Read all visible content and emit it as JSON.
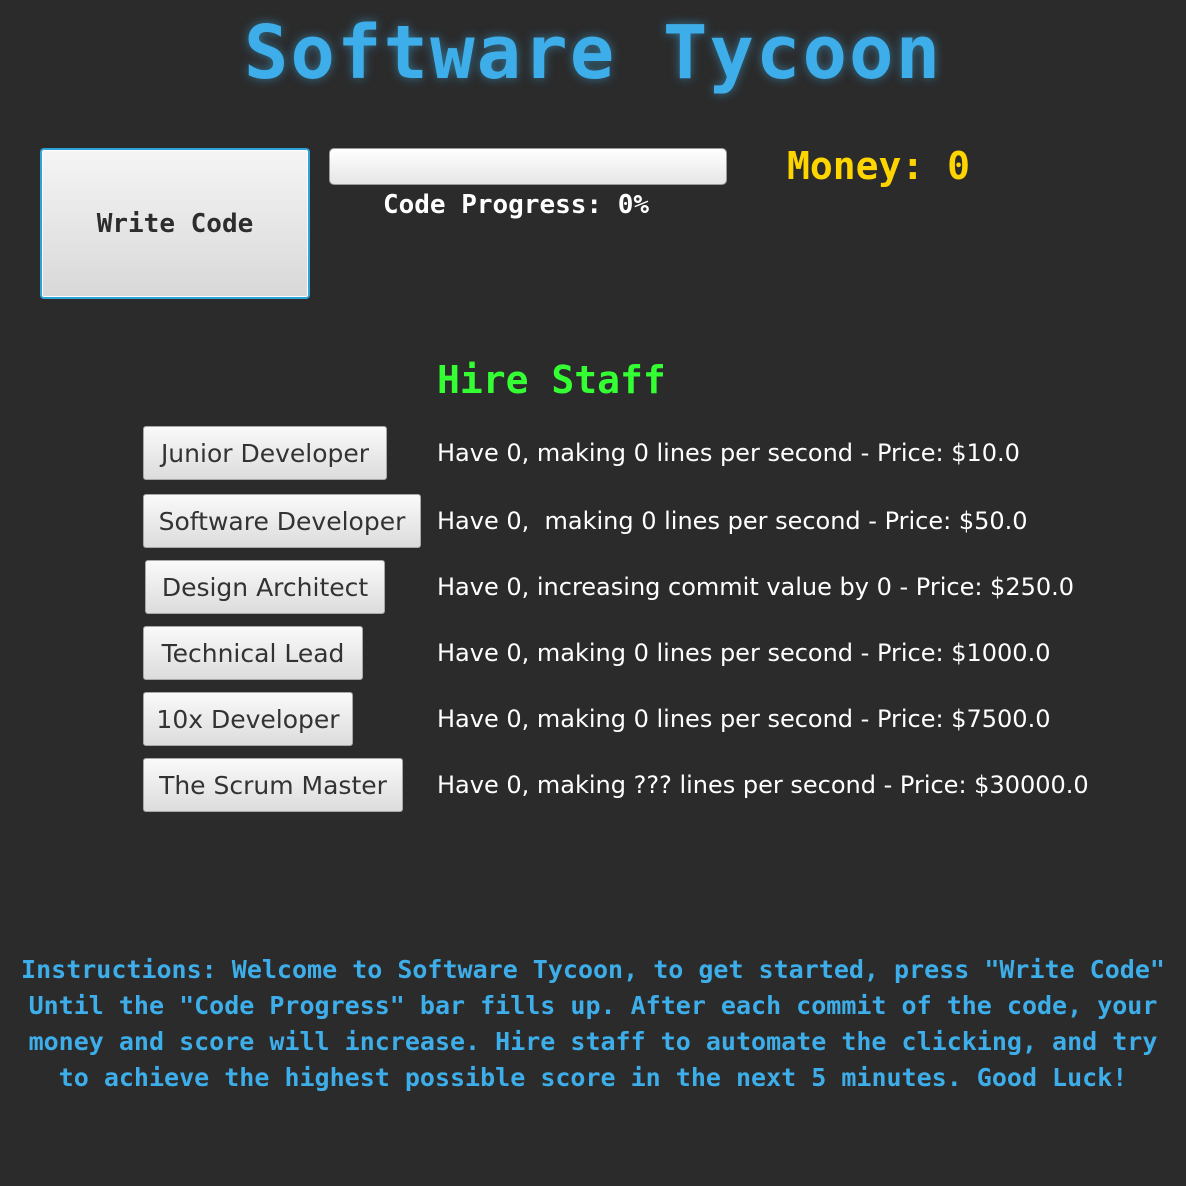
{
  "title": "Software Tycoon",
  "write_code_label": "Write Code",
  "progress": {
    "fraction": 0,
    "label": "Code Progress: 0%"
  },
  "money_label": "Money: 0",
  "hire_heading": "Hire Staff",
  "staff": [
    {
      "button": "Junior Developer",
      "desc": "Have 0, making 0 lines per second - Price: $10.0"
    },
    {
      "button": "Software Developer",
      "desc": "Have 0,  making 0 lines per second - Price: $50.0"
    },
    {
      "button": "Design Architect",
      "desc": "Have 0, increasing commit value by 0 - Price: $250.0"
    },
    {
      "button": "Technical Lead",
      "desc": "Have 0, making 0 lines per second - Price: $1000.0"
    },
    {
      "button": "10x Developer",
      "desc": "Have 0, making 0 lines per second - Price: $7500.0"
    },
    {
      "button": "The Scrum Master",
      "desc": "Have 0, making ??? lines per second - Price: $30000.0"
    }
  ],
  "instructions": "Instructions: Welcome to Software Tycoon, to get started, press \"Write Code\" Until the \"Code Progress\" bar fills up. After each commit of the code, your money and score will increase. Hire staff to automate the clicking, and try to achieve the highest possible score in the next 5 minutes. Good Luck!",
  "colors": {
    "background": "#2b2b2b",
    "title": "#3daee9",
    "money": "#ffd500",
    "hire_heading": "#33ff33",
    "instructions": "#3daee9"
  }
}
